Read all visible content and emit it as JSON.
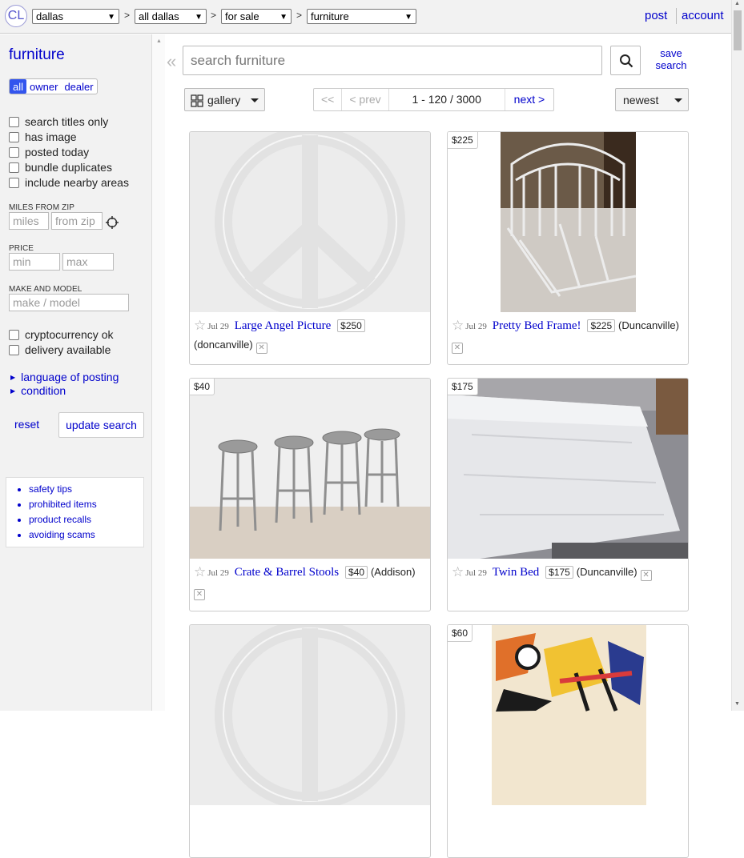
{
  "header": {
    "logo": "CL",
    "breadcrumbs": [
      "dallas",
      "all dallas",
      "for sale",
      "furniture"
    ],
    "separator": ">",
    "post": "post",
    "account": "account"
  },
  "sidebar": {
    "title": "furniture",
    "seller_types": [
      "all",
      "owner",
      "dealer"
    ],
    "checkboxes": [
      "search titles only",
      "has image",
      "posted today",
      "bundle duplicates",
      "include nearby areas"
    ],
    "miles_label": "MILES FROM ZIP",
    "miles_placeholder": "miles",
    "zip_placeholder": "from zip",
    "price_label": "PRICE",
    "min_placeholder": "min",
    "max_placeholder": "max",
    "make_label": "MAKE AND MODEL",
    "make_placeholder": "make / model",
    "checkboxes2": [
      "cryptocurrency ok",
      "delivery available"
    ],
    "expanders": [
      "language of posting",
      "condition"
    ],
    "reset": "reset",
    "update": "update search",
    "help_links": [
      "safety tips",
      "prohibited items",
      "product recalls",
      "avoiding scams"
    ]
  },
  "search": {
    "placeholder": "search furniture",
    "save_line1": "save",
    "save_line2": "search"
  },
  "controls": {
    "view": "gallery",
    "first": "<<",
    "prev": "< prev",
    "range": "1 - 120 / 3000",
    "next": "next >",
    "sort": "newest"
  },
  "listings": [
    {
      "date": "Jul 29",
      "title": "Large Angel Picture",
      "price": "$250",
      "location": "(doncanville)",
      "tag": ""
    },
    {
      "date": "Jul 29",
      "title": "Pretty Bed Frame!",
      "price": "$225",
      "location": "(Duncanville)",
      "tag": "$225"
    },
    {
      "date": "Jul 29",
      "title": "Crate & Barrel Stools",
      "price": "$40",
      "location": "(Addison)",
      "tag": "$40"
    },
    {
      "date": "Jul 29",
      "title": "Twin Bed",
      "price": "$175",
      "location": "(Duncanville)",
      "tag": "$175"
    },
    {
      "tag": "$60"
    }
  ]
}
